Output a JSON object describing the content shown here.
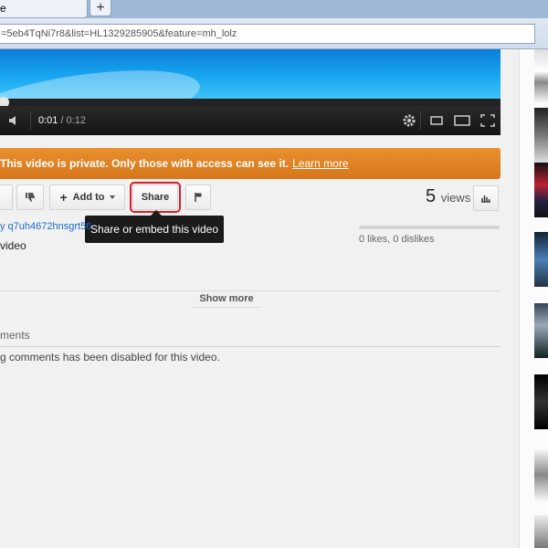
{
  "browser": {
    "tab_title": "e",
    "new_tab_icon": "+",
    "url": "=5eb4TqNi7r8&list=HL1329285905&feature=mh_lolz"
  },
  "player": {
    "current_time": "0:01",
    "separator": " / ",
    "duration": "0:12",
    "progress_fraction": 0.08
  },
  "banner": {
    "message": "This video is private. Only those with access can see it.",
    "link": "Learn more",
    "color": "#e08424"
  },
  "actions": {
    "add_to_label": "Add to",
    "add_to_prefix": "+",
    "share_label": "Share",
    "share_tooltip": "Share or embed this video"
  },
  "stats": {
    "views_count": "5",
    "views_label": "views",
    "likes_text": "0 likes, 0 dislikes"
  },
  "info": {
    "uploader": "y q7uh4672hnsgrt56",
    "description": "video",
    "show_more": "Show more"
  },
  "comments": {
    "heading": "ments",
    "note": "g comments has been disabled for this video."
  }
}
